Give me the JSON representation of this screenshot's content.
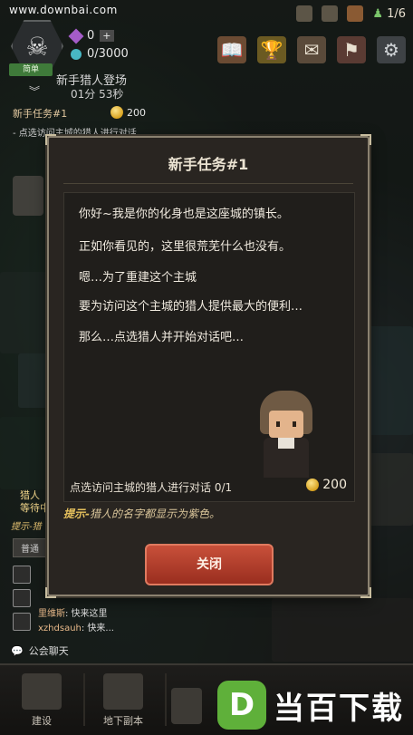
{
  "watermark_top": "www.downbai.com",
  "hud": {
    "rank_label": "简单",
    "gems": "0",
    "mana": "0/3000",
    "hunters_count": "1/6",
    "event_title": "新手猎人登场",
    "event_timer": "01分 53秒"
  },
  "side_quest": {
    "title": "新手任务#1",
    "reward": "200",
    "desc": "- 点选访问主城的猎人进行对话"
  },
  "modal": {
    "title": "新手任务#1",
    "lines": [
      "你好~我是你的化身也是这座城的镇长。",
      "正如你看见的，这里很荒芜什么也没有。",
      "嗯…为了重建这个主城",
      "要为访问这个主城的猎人提供最大的便利…",
      "那么…点选猎人并开始对话吧…"
    ],
    "task_text": "点选访问主城的猎人进行对话 0/1",
    "reward": "200",
    "tip_prefix": "提示-",
    "tip_text": "猎人的名字都显示为紫色。",
    "close_label": "关闭"
  },
  "left_panel": {
    "hunter_tag_1": "猎人",
    "hunter_tag_2": "等待中",
    "tip_label": "提示-猎",
    "normal": "普通"
  },
  "chat": [
    {
      "name": "里维斯",
      "text": ": 快来这里"
    },
    {
      "name": "xzhdsauh",
      "text": ": 快来..."
    }
  ],
  "guild_chat": "公会聊天",
  "nav": {
    "build": "建设",
    "dungeon": "地下副本"
  },
  "logo": {
    "letter": "D",
    "text": "当百下载"
  },
  "colors": {
    "close_button": "#b43e2a",
    "tip": "#e6c15d",
    "logo_green": "#5fb03a"
  }
}
